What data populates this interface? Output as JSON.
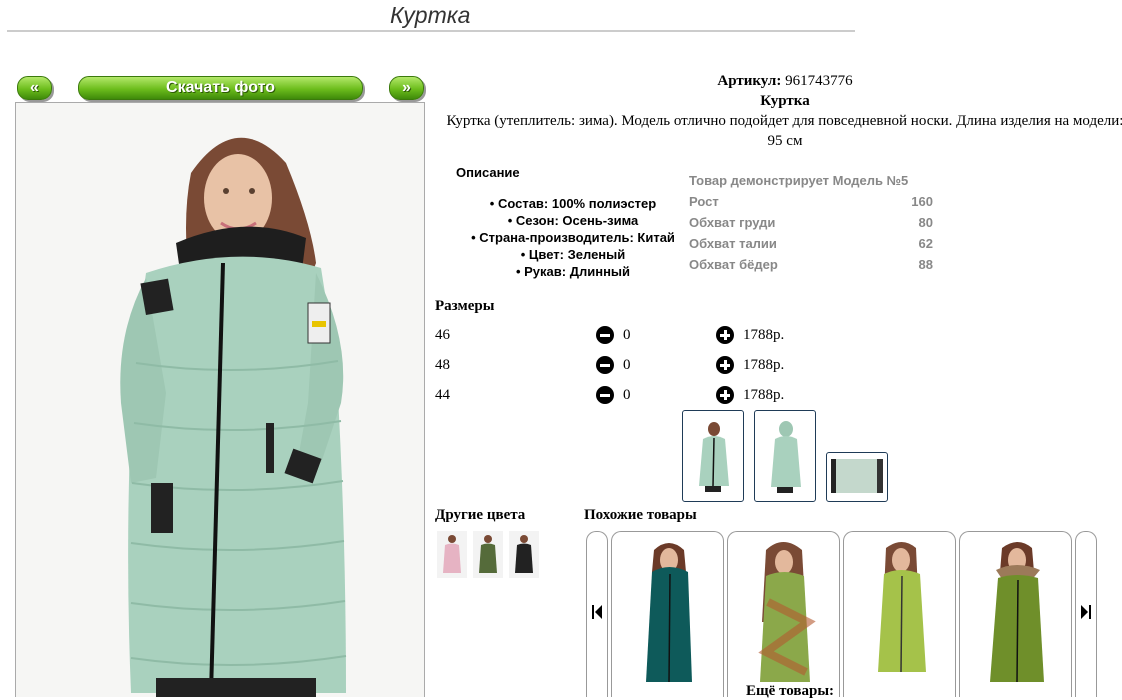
{
  "page": {
    "title": "Куртка"
  },
  "gallery": {
    "prev_label": "«",
    "download_label": "Скачать фото",
    "next_label": "»"
  },
  "product": {
    "article_label": "Артикул:",
    "article_value": "961743776",
    "name": "Куртка",
    "summary": "Куртка (утеплитель: зима). Модель отлично подойдет для повседневной носки. Длина изделия на модели: 95 см"
  },
  "description": {
    "title": "Описание",
    "items": [
      "Состав: 100% полиэстер",
      "Сезон: Осень-зима",
      "Страна-производитель: Китай",
      "Цвет: Зеленый",
      "Рукав: Длинный"
    ]
  },
  "model_info": {
    "title": "Товар демонстрирует Модель №5",
    "rows": [
      {
        "label": "Рост",
        "value": "160"
      },
      {
        "label": "Обхват груди",
        "value": "80"
      },
      {
        "label": "Обхват талии",
        "value": "62"
      },
      {
        "label": "Обхват бёдер",
        "value": "88"
      }
    ]
  },
  "sizes": {
    "title": "Размеры",
    "rows": [
      {
        "size": "46",
        "qty": "0",
        "price": "1788р."
      },
      {
        "size": "48",
        "qty": "0",
        "price": "1788р."
      },
      {
        "size": "44",
        "qty": "0",
        "price": "1788р."
      }
    ]
  },
  "other_colors": {
    "title": "Другие цвета"
  },
  "similar": {
    "title": "Похожие товары"
  },
  "more": {
    "label": "Ещё товары:"
  },
  "colors": {
    "button_green": "#6cbd1c",
    "jacket_mint": "#a9d1be",
    "thumb_border": "#1f3b57",
    "muted_text": "#888888"
  }
}
